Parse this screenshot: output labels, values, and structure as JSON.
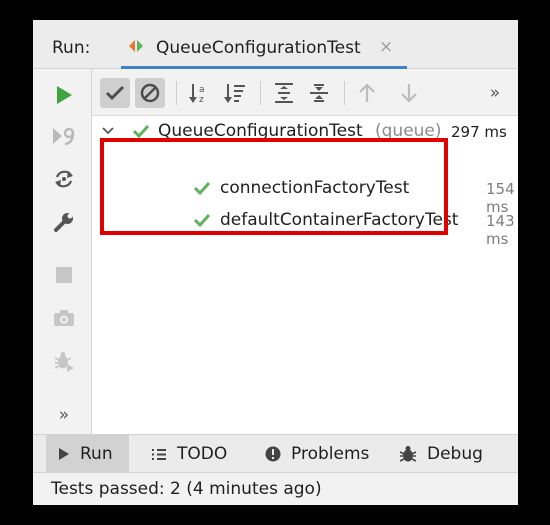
{
  "header": {
    "run_label": "Run:",
    "tab_title": "QueueConfigurationTest",
    "tab_close": "×"
  },
  "toolbar": {
    "more": "»"
  },
  "left_toolbar": {
    "more": "»"
  },
  "tree": {
    "root": {
      "name": "QueueConfigurationTest",
      "suffix": "(queue)",
      "duration": "297 ms"
    },
    "children": [
      {
        "name": "connectionFactoryTest",
        "duration": "154 ms"
      },
      {
        "name": "defaultContainerFactoryTest",
        "duration": "143 ms"
      }
    ]
  },
  "bottom_tabs": [
    {
      "label": "Run",
      "icon": "run-icon"
    },
    {
      "label": "TODO",
      "icon": "list-icon"
    },
    {
      "label": "Problems",
      "icon": "problems-icon"
    },
    {
      "label": "Debug",
      "icon": "bug-icon"
    }
  ],
  "status": {
    "text": "Tests passed: 2 (4 minutes ago)"
  },
  "colors": {
    "pass_green": "#5fb35f",
    "run_green": "#3fa43f",
    "highlight_red": "#e00000",
    "tab_underline": "#4083c9"
  }
}
